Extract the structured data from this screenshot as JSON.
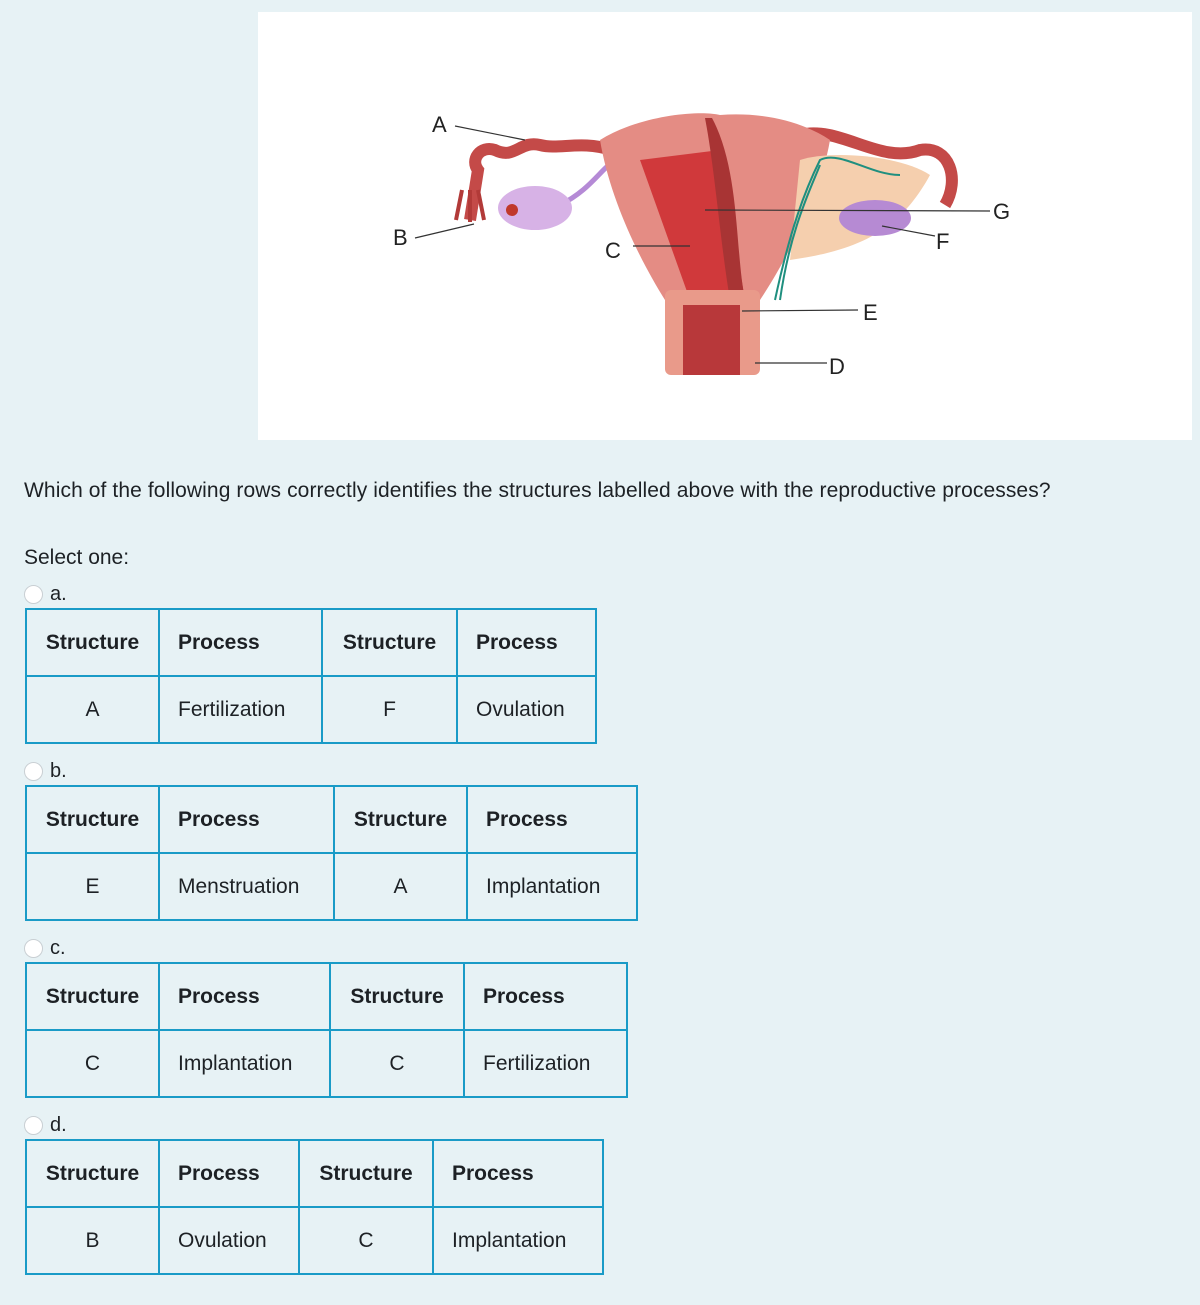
{
  "diagram": {
    "labels": {
      "A": "A",
      "B": "B",
      "C": "C",
      "D": "D",
      "E": "E",
      "F": "F",
      "G": "G"
    }
  },
  "question": "Which of the following rows correctly identifies the structures labelled above with the reproductive processes?",
  "select_prompt": "Select one:",
  "headers": [
    "Structure",
    "Process",
    "Structure",
    "Process"
  ],
  "options": [
    {
      "letter": "a.",
      "row": [
        "A",
        "Fertilization",
        "F",
        "Ovulation"
      ]
    },
    {
      "letter": "b.",
      "row": [
        "E",
        "Menstruation",
        "A",
        "Implantation"
      ]
    },
    {
      "letter": "c.",
      "row": [
        "C",
        "Implantation",
        "C",
        "Fertilization"
      ]
    },
    {
      "letter": "d.",
      "row": [
        "B",
        "Ovulation",
        "C",
        "Implantation"
      ]
    }
  ],
  "colors": {
    "table_border": "#1a9bc7",
    "background": "#e7f2f5"
  }
}
